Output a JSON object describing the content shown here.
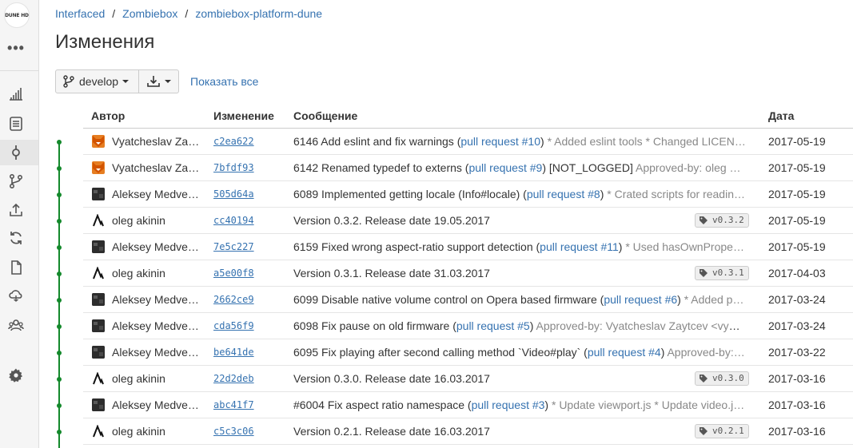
{
  "sidebar": {
    "logo_text": "DUNE HD",
    "more": "•••",
    "icons": [
      "statistics-icon",
      "source-icon",
      "commits-icon",
      "branches-icon",
      "pull-requests-icon",
      "sync-icon",
      "file-icon",
      "cloud-icon",
      "users-icon",
      "settings-icon"
    ]
  },
  "breadcrumb": {
    "project": "Interfaced",
    "repo_group": "Zombiebox",
    "repo": "zombiebox-platform-dune"
  },
  "page": {
    "title": "Изменения"
  },
  "toolbar": {
    "branch": "develop",
    "show_all": "Показать все"
  },
  "table": {
    "headers": {
      "author": "Автор",
      "change": "Изменение",
      "message": "Сообщение",
      "date": "Дата"
    },
    "rows": [
      {
        "author": "Vyatcheslav Za…",
        "hash": "c2ea622",
        "msg": "6146 Add eslint and fix warnings (",
        "pr": "pull request #10",
        "tail": ") ",
        "note": "* Added eslint tools * Changed LICEN…",
        "tag": "",
        "date": "2017-05-19",
        "avatar": "fox"
      },
      {
        "author": "Vyatcheslav Za…",
        "hash": "7bfdf93",
        "msg": "6142 Renamed typedef to externs (",
        "pr": "pull request #9",
        "tail": ") [NOT_LOGGED] ",
        "note": "Approved-by: oleg …",
        "tag": "",
        "date": "2017-05-19",
        "avatar": "fox"
      },
      {
        "author": "Aleksey Medve…",
        "hash": "505d64a",
        "msg": "6089 Implemented getting locale (Info#locale) (",
        "pr": "pull request #8",
        "tail": ") ",
        "note": "* Crated scripts for readin…",
        "tag": "",
        "date": "2017-05-19",
        "avatar": "dark"
      },
      {
        "author": "oleg akinin",
        "hash": "cc40194",
        "msg": "Version 0.3.2. Release date 19.05.2017",
        "pr": "",
        "tail": "",
        "note": "",
        "tag": "v0.3.2",
        "date": "2017-05-19",
        "avatar": "oleg"
      },
      {
        "author": "Aleksey Medve…",
        "hash": "7e5c227",
        "msg": "6159 Fixed wrong aspect-ratio support detection (",
        "pr": "pull request #11",
        "tail": ") ",
        "note": "* Used hasOwnPrope…",
        "tag": "",
        "date": "2017-05-19",
        "avatar": "dark"
      },
      {
        "author": "oleg akinin",
        "hash": "a5e00f8",
        "msg": "Version 0.3.1. Release date 31.03.2017",
        "pr": "",
        "tail": "",
        "note": "",
        "tag": "v0.3.1",
        "date": "2017-04-03",
        "avatar": "oleg"
      },
      {
        "author": "Aleksey Medve…",
        "hash": "2662ce9",
        "msg": "6099 Disable native volume control on Opera based firmware (",
        "pr": "pull request #6",
        "tail": ") ",
        "note": "* Added p…",
        "tag": "",
        "date": "2017-03-24",
        "avatar": "dark"
      },
      {
        "author": "Aleksey Medve…",
        "hash": "cda56f9",
        "msg": "6098 Fix pause on old firmware (",
        "pr": "pull request #5",
        "tail": ") ",
        "note": "Approved-by: Vyatcheslav Zaytcev <vya…",
        "tag": "",
        "date": "2017-03-24",
        "avatar": "dark"
      },
      {
        "author": "Aleksey Medve…",
        "hash": "be641de",
        "msg": "6095 Fix playing after second calling method `Video#play` (",
        "pr": "pull request #4",
        "tail": ") ",
        "note": "Approved-by:…",
        "tag": "",
        "date": "2017-03-22",
        "avatar": "dark"
      },
      {
        "author": "oleg akinin",
        "hash": "22d2deb",
        "msg": "Version 0.3.0. Release date 16.03.2017",
        "pr": "",
        "tail": "",
        "note": "",
        "tag": "v0.3.0",
        "date": "2017-03-16",
        "avatar": "oleg"
      },
      {
        "author": "Aleksey Medve…",
        "hash": "abc41f7",
        "msg": "#6004 Fix aspect ratio namespace (",
        "pr": "pull request #3",
        "tail": ") ",
        "note": "* Update viewport.js * Update video.j…",
        "tag": "",
        "date": "2017-03-16",
        "avatar": "dark"
      },
      {
        "author": "oleg akinin",
        "hash": "c5c3c06",
        "msg": "Version 0.2.1. Release date 16.03.2017",
        "pr": "",
        "tail": "",
        "note": "",
        "tag": "v0.2.1",
        "date": "2017-03-16",
        "avatar": "oleg"
      }
    ]
  }
}
